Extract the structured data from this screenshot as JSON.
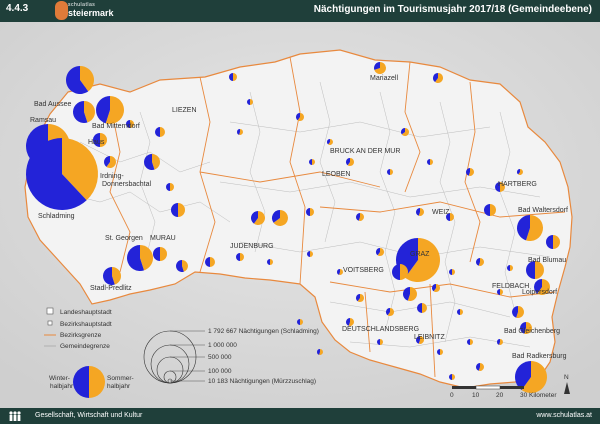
{
  "header": {
    "code": "4.4.3",
    "logo_top": "schulatlas",
    "logo_bottom": "steiermark",
    "title": "Nächtigungen im Tourismusjahr 2017/18 (Gemeindeebene)"
  },
  "colors": {
    "winter": "#2323d8",
    "summer": "#f5a623",
    "header_bg": "#1f3f3a",
    "boundary_district": "#e8893e",
    "boundary_municipal": "#bcbcbc",
    "land": "#f4f4f4"
  },
  "places": [
    {
      "name": "Mariazell"
    },
    {
      "name": "Bad Aussee"
    },
    {
      "name": "Ramsau"
    },
    {
      "name": "Bad Mitterndorf"
    },
    {
      "name": "Haus"
    },
    {
      "name": "LIEZEN"
    },
    {
      "name": "Irdning-Donnersbachtal"
    },
    {
      "name": "Schladming"
    },
    {
      "name": "BRUCK AN DER MUR"
    },
    {
      "name": "LEOBEN"
    },
    {
      "name": "DEUTSCHLANDSBERG"
    },
    {
      "name": "HARTBERG"
    },
    {
      "name": "Bad Waltersdorf"
    },
    {
      "name": "WEIZ"
    },
    {
      "name": "JUDENBURG"
    },
    {
      "name": "St. Georgen"
    },
    {
      "name": "MURAU"
    },
    {
      "name": "Stadl-Predlitz"
    },
    {
      "name": "GRAZ"
    },
    {
      "name": "Bad Blumau"
    },
    {
      "name": "FELDBACH"
    },
    {
      "name": "Loipersdorf"
    },
    {
      "name": "VOITSBERG"
    },
    {
      "name": "Bad Gleichenberg"
    },
    {
      "name": "LEIBNITZ"
    },
    {
      "name": "Bad Radkersburg"
    }
  ],
  "legend": {
    "landeshauptstadt": "Landeshauptstadt",
    "bezirkshauptstadt": "Bezirkshauptstadt",
    "bezirksgrenze": "Bezirksgrenze",
    "gemeindegrenze": "Gemeindegrenze",
    "size_1": "1 792 667 Nächtigungen (Schladming)",
    "size_2": "1 000 000",
    "size_3": "500 000",
    "size_4": "100 000",
    "size_5": "10 183 Nächtigungen (Mürzzuschlag)",
    "winter": "Winter-\nhalbjahr",
    "summer": "Sommer-\nhalbjahr",
    "winter_1": "Winter-",
    "winter_2": "halbjahr",
    "summer_1": "Sommer-",
    "summer_2": "halbjahr"
  },
  "scale": {
    "ticks": [
      "0",
      "10",
      "20",
      "30 Kilometer"
    ],
    "north": "N"
  },
  "footer": {
    "left": "Gesellschaft, Wirtschaft und Kultur",
    "right": "www.schulatlas.at"
  }
}
